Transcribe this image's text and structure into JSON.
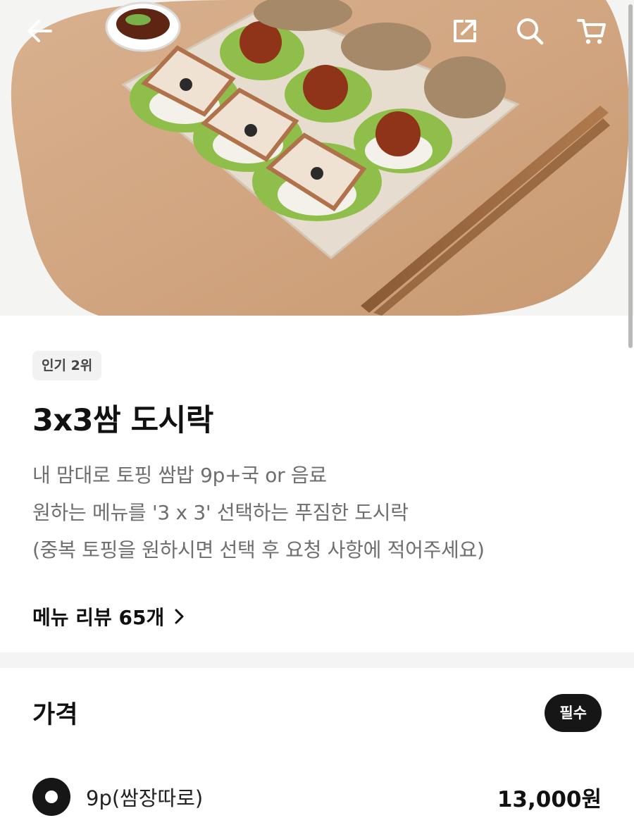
{
  "header": {
    "icons": [
      "back-arrow-icon",
      "share-icon",
      "search-icon",
      "cart-icon"
    ]
  },
  "hero": {
    "image_subject": "product-photo"
  },
  "menu": {
    "badge": "인기 2위",
    "title": "3x3쌈 도시락",
    "description": [
      "내 맘대로 토핑 쌈밥 9p+국 or 음료",
      "원하는 메뉴를 '3 x 3' 선택하는 푸짐한 도시락",
      "(중복 토핑을 원하시면 선택 후 요청 사항에 적어주세요)"
    ],
    "review_link": "메뉴 리뷰 65개"
  },
  "price_section": {
    "title": "가격",
    "required_badge": "필수",
    "options": [
      {
        "label": "9p(쌈장따로)",
        "price": "13,000원",
        "selected": true
      }
    ]
  },
  "colors": {
    "accent": "#161616",
    "muted_text": "#6e6e6e",
    "badge_bg": "#f2f2f2",
    "divider": "#f4f4f5"
  }
}
